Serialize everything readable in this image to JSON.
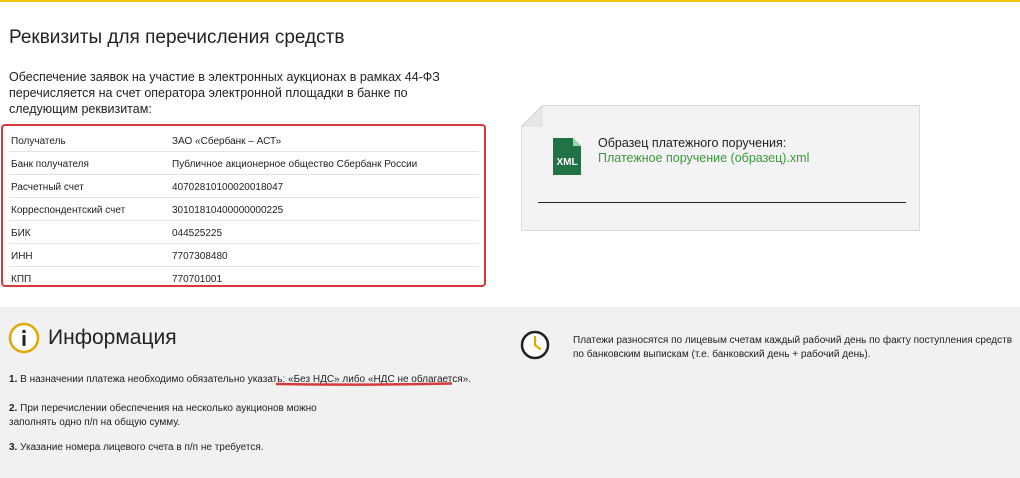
{
  "page": {
    "title": "Реквизиты для перечисления средств",
    "intro": "Обеспечение заявок на участие в электронных аукционах в рамках 44-ФЗ перечисляется на счет оператора электронной площадки в банке по следующим реквизитам:"
  },
  "details": {
    "rows": [
      {
        "label": "Получатель",
        "value": "ЗАО «Сбербанк – АСТ»"
      },
      {
        "label": "Банк получателя",
        "value": "Публичное акционерное общество Сбербанк России"
      },
      {
        "label": "Расчетный счет",
        "value": "40702810100020018047"
      },
      {
        "label": "Корреспондентский счет",
        "value": "30101810400000000225"
      },
      {
        "label": "БИК",
        "value": "044525225"
      },
      {
        "label": "ИНН",
        "value": "7707308480"
      },
      {
        "label": "КПП",
        "value": "770701001"
      }
    ]
  },
  "sample": {
    "icon_text": "XML",
    "label": "Образец платежного поручения:",
    "link": "Платежное поручение (образец).xml"
  },
  "info": {
    "title": "Информация",
    "items": [
      {
        "num": "1.",
        "text": "В назначении платежа необходимо обязательно указать: ",
        "highlight": "«Без НДС» либо «НДС не облагается»."
      },
      {
        "num": "2.",
        "text": "При перечислении обеспечения на несколько аукционов можно заполнять одно п/п на общую сумму."
      },
      {
        "num": "3.",
        "text": "Указание номера лицевого счета в п/п не требуется."
      }
    ],
    "schedule_text": "Платежи разносятся по лицевым счетам каждый рабочий день по факту поступления средств по банковским выпискам (т.е. банковский день + рабочий день)."
  },
  "colors": {
    "accent_border": "#d63a3a",
    "link_green": "#3a9a3a",
    "xml_icon_green": "#217346",
    "top_line": "#f2c600",
    "info_icon": "#e0a800"
  }
}
